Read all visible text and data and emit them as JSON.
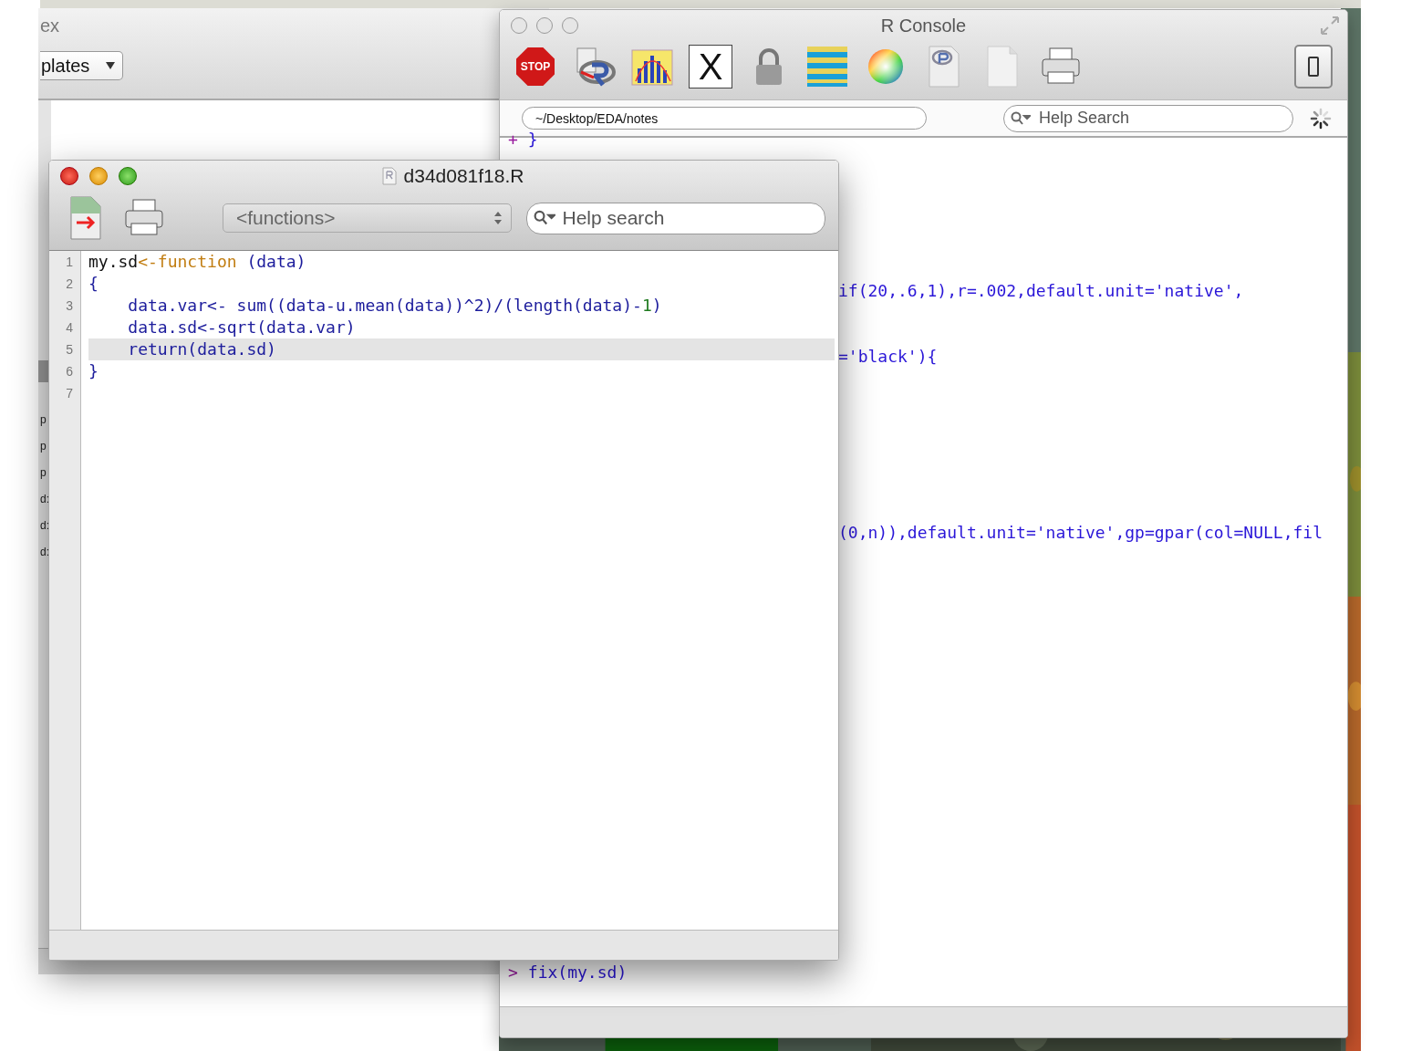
{
  "back_window": {
    "title": "ex",
    "popup": "plates",
    "sidebar_fragments": [
      "p",
      "p",
      "p",
      "d:",
      "d:",
      "d:"
    ]
  },
  "console_window": {
    "title": "R Console",
    "active": false,
    "toolbar": [
      {
        "kind": "stop",
        "label": "STOP"
      },
      {
        "kind": "script"
      },
      {
        "kind": "chart"
      },
      {
        "kind": "x11",
        "label": "X"
      },
      {
        "kind": "lock"
      },
      {
        "kind": "list"
      },
      {
        "kind": "colors"
      },
      {
        "kind": "rdoc"
      },
      {
        "kind": "blank"
      },
      {
        "kind": "print"
      }
    ],
    "path": "~/Desktop/EDA/notes",
    "search_placeholder": "Help Search",
    "lines": [
      {
        "prompt": "+",
        "text": "}"
      },
      {
        "text": "if(20,.6,1),r=.002,default.unit='native',"
      },
      {
        "text": "='black'){"
      },
      {
        "text": "(0,n)),default.unit='native',gp=gpar(col=NULL,fil"
      }
    ],
    "command": {
      "prompt": ">",
      "text": "fix(my.sd)"
    }
  },
  "editor_window": {
    "title": "d34d081f18.R",
    "active": true,
    "functions_popup": "<functions>",
    "search_placeholder": "Help search",
    "lines": [
      {
        "number": "1",
        "current": false,
        "tokens": [
          {
            "text": "my.sd",
            "kind": "ident"
          },
          {
            "text": "<-function",
            "kind": "keyword"
          },
          {
            "text": " (data)",
            "kind": "code"
          }
        ]
      },
      {
        "number": "2",
        "current": false,
        "tokens": [
          {
            "text": "{",
            "kind": "code"
          }
        ]
      },
      {
        "number": "3",
        "current": false,
        "tokens": [
          {
            "text": "    data.var<- sum((data-u.mean(data))^2)/(length(data)-",
            "kind": "code"
          },
          {
            "text": "1",
            "kind": "number"
          },
          {
            "text": ")",
            "kind": "code"
          }
        ]
      },
      {
        "number": "4",
        "current": false,
        "tokens": [
          {
            "text": "    data.sd<-sqrt(data.var)",
            "kind": "code"
          }
        ]
      },
      {
        "number": "5",
        "current": true,
        "tokens": [
          {
            "text": "    return(data.sd)",
            "kind": "code"
          }
        ]
      },
      {
        "number": "6",
        "current": false,
        "tokens": [
          {
            "text": "}",
            "kind": "code"
          }
        ]
      },
      {
        "number": "7",
        "current": false
      }
    ]
  }
}
